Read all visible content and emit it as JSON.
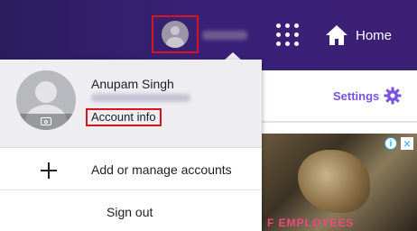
{
  "header": {
    "home_label": "Home",
    "profile_icon": "user-avatar-icon",
    "apps_icon": "apps-grid-icon",
    "home_icon": "home-icon"
  },
  "account_menu": {
    "user_name": "Anupam Singh",
    "account_info_label": "Account info",
    "add_accounts_label": "Add or manage accounts",
    "sign_out_label": "Sign out"
  },
  "page": {
    "settings_label": "Settings",
    "ad_text": "F EMPLOYEES"
  },
  "colors": {
    "header_bg": "#3a2178",
    "highlight_border": "#d6151c",
    "settings_accent": "#7a52e0",
    "ad_text": "#f04c7d"
  }
}
